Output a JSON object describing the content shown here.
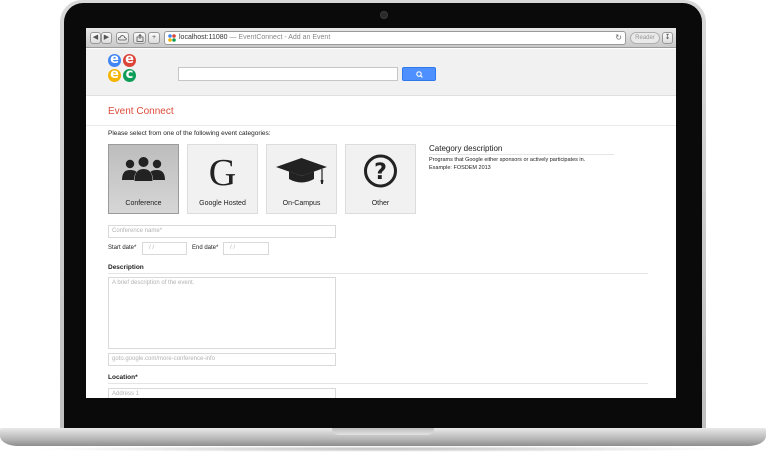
{
  "browser": {
    "url": "localhost:11080",
    "separator": " — ",
    "page_title": "EventConnect - Add an Event",
    "reader_label": "Reader",
    "reload_icon": "reload-icon"
  },
  "app": {
    "logo_letters": [
      "e",
      "e",
      "e",
      "c"
    ],
    "logo_colors": [
      "#4285f4",
      "#db4437",
      "#f4b400",
      "#0f9d58"
    ],
    "search_placeholder": "",
    "accent": "#dd4b39",
    "button_color": "#4d90fe"
  },
  "page": {
    "title": "Event Connect",
    "prompt": "Please select from one of the following event categories:"
  },
  "categories": [
    {
      "label": "Conference",
      "icon": "people-icon",
      "selected": true
    },
    {
      "label": "Google Hosted",
      "icon": "google-g-icon",
      "selected": false
    },
    {
      "label": "On-Campus",
      "icon": "graduation-cap-icon",
      "selected": false
    },
    {
      "label": "Other",
      "icon": "question-mark-icon",
      "selected": false
    }
  ],
  "category_description": {
    "title": "Category description",
    "line1": "Programs that Google either sponsors or actively participates in.",
    "line2": "Example: FOSDEM 2013"
  },
  "form": {
    "name_placeholder": "Conference name*",
    "start_label": "Start date*",
    "start_placeholder": "/ /",
    "end_label": "End date*",
    "end_placeholder": "/ /",
    "description_heading": "Description",
    "description_placeholder": "A brief description of the event.",
    "url_placeholder": "goto.google.com/more-conference-info",
    "location_heading": "Location*",
    "address_placeholder": "Address 1"
  }
}
